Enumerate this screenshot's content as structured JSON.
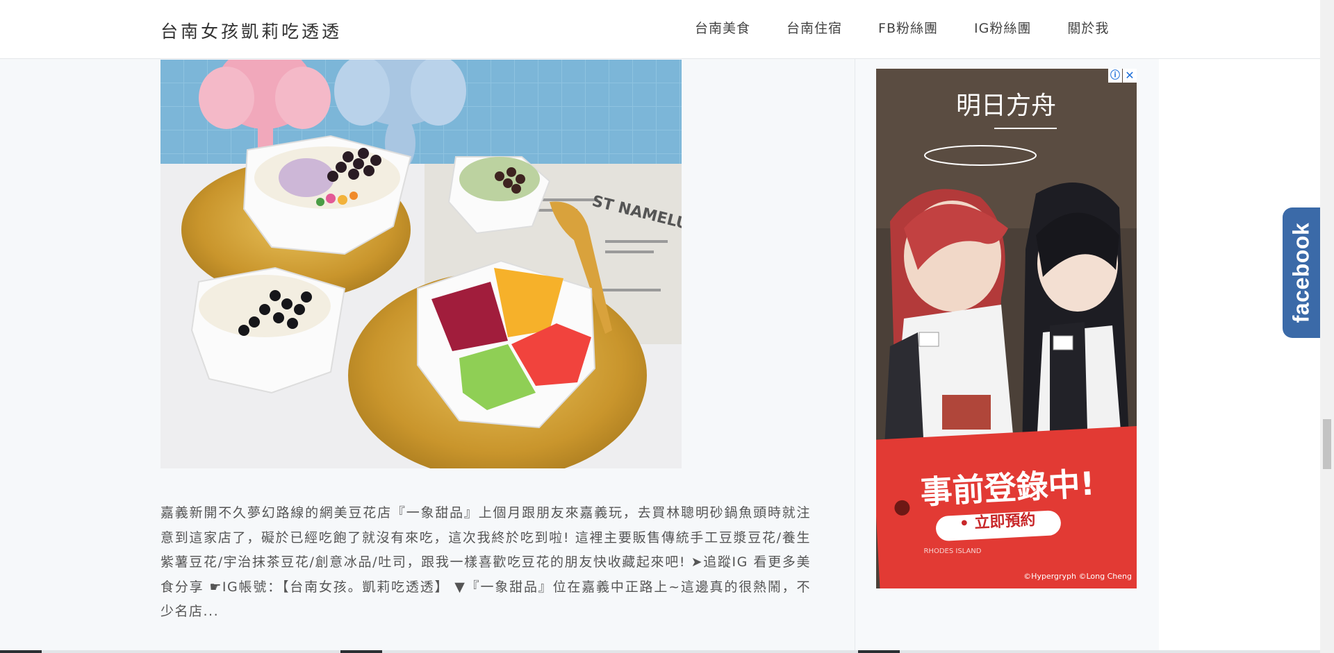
{
  "header": {
    "site_title": "台南女孩凱莉吃透透",
    "nav": [
      "台南美食",
      "台南住宿",
      "FB粉絲團",
      "IG粉絲團",
      "關於我"
    ]
  },
  "post": {
    "excerpt": "嘉義新開不久夢幻路線的網美豆花店『一象甜品』上個月跟朋友來嘉義玩，去買林聰明砂鍋魚頭時就注意到這家店了，礙於已經吃飽了就沒有來吃，這次我終於吃到啦! 這裡主要販售傳統手工豆漿豆花/養生紫薯豆花/宇治抹茶豆花/創意冰品/吐司，跟我一樣喜歡吃豆花的朋友快收藏起來吧! ➤追蹤IG 看更多美食分享 ☛IG帳號：【台南女孩。凱莉吃透透】 ▼『一象甜品』位在嘉義中正路上~這邊真的很熱鬧，不少名店...",
    "image_print": "ST NAMELU"
  },
  "ad": {
    "logo": "明日方舟",
    "banner_main": "事前登錄中!",
    "banner_button": "• 立即預約",
    "small_tag": "RHODES ISLAND",
    "copyright": "©Hypergryph ©Long Cheng",
    "info_icon": "ⓘ",
    "close_icon": "✕"
  },
  "facebook_tab": {
    "label": "facebook"
  },
  "colors": {
    "facebook_blue": "#3b6aa8",
    "ad_red": "#e23a34",
    "page_bg": "#f6f8fa"
  }
}
